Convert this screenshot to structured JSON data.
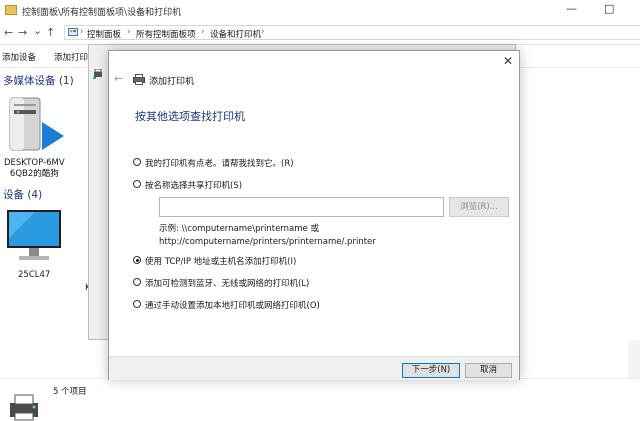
{
  "window": {
    "path_title": "控制面板\\所有控制面板项\\设备和打印机",
    "minimize": "—",
    "maximize": "□"
  },
  "nav": {
    "back": "←",
    "forward": "→",
    "recent": "⌄",
    "up": "↑",
    "breadcrumbs": [
      "控制面板",
      "所有控制面板项",
      "设备和打印机"
    ]
  },
  "commands": {
    "add_device": "添加设备",
    "add_printer": "添加打印机"
  },
  "groups": {
    "multimedia": "多媒体设备 (1)",
    "devices": "设备 (4)"
  },
  "devices": {
    "desktop_line1": "DESKTOP-6MV",
    "desktop_line2": "6QB2的酷狗",
    "monitor": "25CL47",
    "partial": "K"
  },
  "status": {
    "count": "5 个项目"
  },
  "dialog": {
    "close": "✕",
    "back": "←",
    "title": "添加打印机",
    "heading": "按其他选项查找打印机",
    "options": [
      {
        "label": "我的打印机有点老。请帮我找到它。(R)",
        "checked": false
      },
      {
        "label": "按名称选择共享打印机(S)",
        "checked": false
      },
      {
        "label": "使用 TCP/IP 地址或主机名添加打印机(I)",
        "checked": true
      },
      {
        "label": "添加可检测到蓝牙、无线或网络的打印机(L)",
        "checked": false
      },
      {
        "label": "通过手动设置添加本地打印机或网络打印机(O)",
        "checked": false
      }
    ],
    "path_value": "",
    "browse_button": "浏览(R)...",
    "example_line1": "示例: \\\\computername\\printername 或",
    "example_line2": "http://computername/printers/printername/.printer",
    "next_button": "下一步(N)",
    "cancel_button": "取消"
  },
  "colors": {
    "link_blue": "#1e3287",
    "accent": "#0078d7",
    "monitor_blue": "#2a9be0"
  }
}
